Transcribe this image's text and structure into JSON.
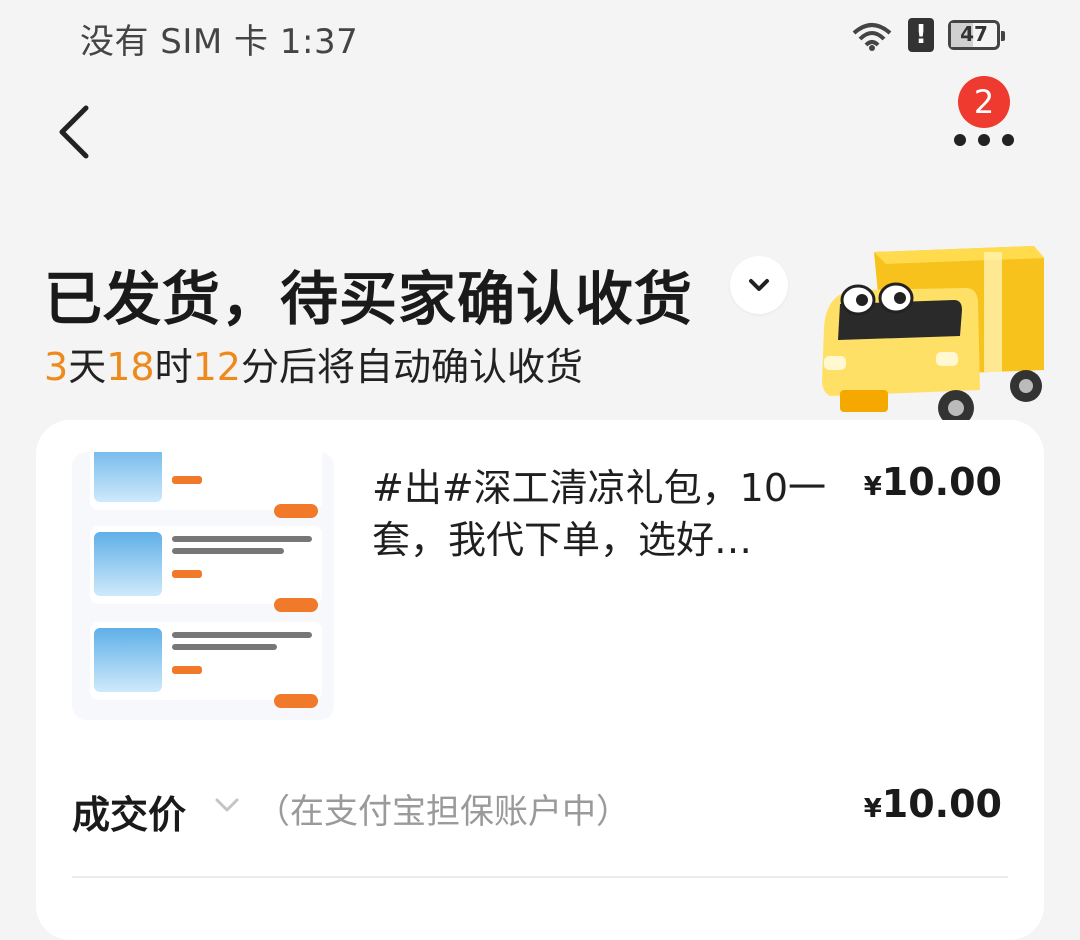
{
  "status_bar": {
    "carrier_time": "没有 SIM 卡 1:37",
    "battery_level": "47",
    "icons": [
      "wifi-icon",
      "alert-icon",
      "battery-icon"
    ]
  },
  "nav": {
    "back_icon": "chevron-left-icon",
    "more_icon": "more-dots-icon",
    "badge_count": "2"
  },
  "order_status": {
    "title": "已发货，待买家确认收货",
    "countdown": {
      "days": "3",
      "days_unit": "天",
      "hours": "18",
      "hours_unit": "时",
      "minutes": "12",
      "minutes_unit": "分后将自动确认收货"
    }
  },
  "product": {
    "title": "#出#深工清凉礼包，10一套，我代下单，选好…",
    "price": "10.00",
    "currency": "¥"
  },
  "deal": {
    "label": "成交价",
    "note": "（在支付宝担保账户中）",
    "price": "10.00",
    "currency": "¥"
  },
  "colors": {
    "accent_orange": "#ee8a1c",
    "badge_red": "#ee3a2f",
    "background": "#f4f4f4"
  }
}
